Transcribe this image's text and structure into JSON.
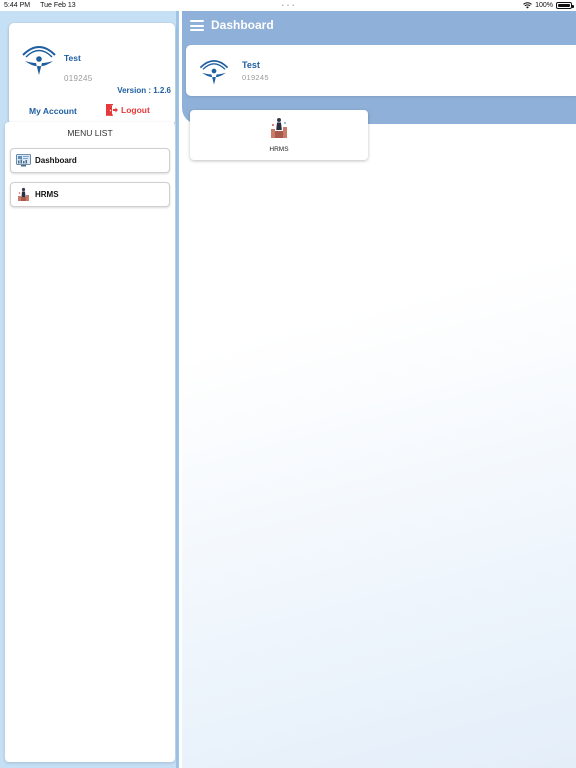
{
  "status_bar": {
    "time": "5:44 PM",
    "date": "Tue Feb 13",
    "battery": "100%",
    "battery_level": 1.0
  },
  "profile": {
    "name": "Test",
    "employee_id": "019245",
    "version": "Version : 1.2.6",
    "my_account_label": "My Account",
    "logout_label": "Logout"
  },
  "menu": {
    "title": "MENU LIST",
    "items": [
      {
        "label": "Dashboard",
        "icon": "dashboard-icon"
      },
      {
        "label": "HRMS",
        "icon": "hrms-icon"
      }
    ]
  },
  "header": {
    "title": "Dashboard"
  },
  "user_card": {
    "name": "Test",
    "employee_id": "019245"
  },
  "modules": [
    {
      "label": "HRMS",
      "icon": "hrms-icon"
    }
  ],
  "colors": {
    "brand_blue": "#1f5fa0",
    "header_blue": "#8fb0d8",
    "sidebar_blue": "#c5dff5",
    "logout_red": "#e63a3a"
  }
}
